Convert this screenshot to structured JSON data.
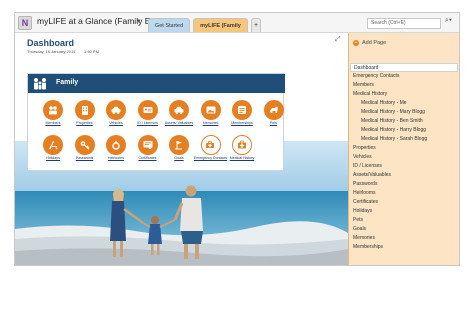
{
  "window": {
    "app_icon": "onenote-icon",
    "notebook_title": "myLIFE at a Glance (Family E...",
    "tabs": [
      {
        "label": "Get Started",
        "color": "#bcd9ee"
      },
      {
        "label": "myLIFE (Family Edition)",
        "color": "#f7c67b"
      },
      {
        "label": "+"
      }
    ],
    "search_placeholder": "Search (Ctrl+E)"
  },
  "page": {
    "title": "Dashboard",
    "date": "Thursday, 16 January 2014",
    "time": "1:50 PM"
  },
  "panel": {
    "title": "Family",
    "header_color": "#1f4e79",
    "tile_color": "#e67e22",
    "tiles": [
      {
        "label": "Members",
        "icon": "members-icon"
      },
      {
        "label": "Properties",
        "icon": "building-icon"
      },
      {
        "label": "Vehicles",
        "icon": "car-icon"
      },
      {
        "label": "ID / Licenses",
        "icon": "id-card-icon"
      },
      {
        "label": "Assets/ Valuables",
        "icon": "car-icon"
      },
      {
        "label": "Memories",
        "icon": "photo-icon"
      },
      {
        "label": "Memberships",
        "icon": "membership-card-icon"
      },
      {
        "label": "Pets",
        "icon": "dog-icon"
      },
      {
        "label": "Holidays",
        "icon": "beach-chair-icon"
      },
      {
        "label": "Passwords",
        "icon": "key-icon"
      },
      {
        "label": "Heirlooms",
        "icon": "ring-icon"
      },
      {
        "label": "Certificates",
        "icon": "certificate-icon"
      },
      {
        "label": "Goals",
        "icon": "goal-icon"
      },
      {
        "label": "Emergency Contacts",
        "icon": "emergency-icon"
      },
      {
        "label": "Medical History",
        "icon": "medical-icon"
      }
    ]
  },
  "nav": {
    "add_page": "Add Page",
    "pages": [
      {
        "label": "Dashboard",
        "selected": true
      },
      {
        "label": "Emergency Contacts"
      },
      {
        "label": "Members"
      },
      {
        "label": "Medical History"
      },
      {
        "label": "Medical History - Me",
        "sub": true
      },
      {
        "label": "Medical History - Mary Blogg",
        "sub": true
      },
      {
        "label": "Medical History - Ben Smith",
        "sub": true
      },
      {
        "label": "Medical History - Harry Blogg",
        "sub": true
      },
      {
        "label": "Medical History - Sarah Blogg",
        "sub": true
      },
      {
        "label": "Properties"
      },
      {
        "label": "Vehicles"
      },
      {
        "label": "ID / Licenses"
      },
      {
        "label": "Assets/Valuables"
      },
      {
        "label": "Passwords"
      },
      {
        "label": "Heirlooms"
      },
      {
        "label": "Certificates"
      },
      {
        "label": "Holidays"
      },
      {
        "label": "Pets"
      },
      {
        "label": "Goals"
      },
      {
        "label": "Memories"
      },
      {
        "label": "Memberships"
      }
    ]
  }
}
